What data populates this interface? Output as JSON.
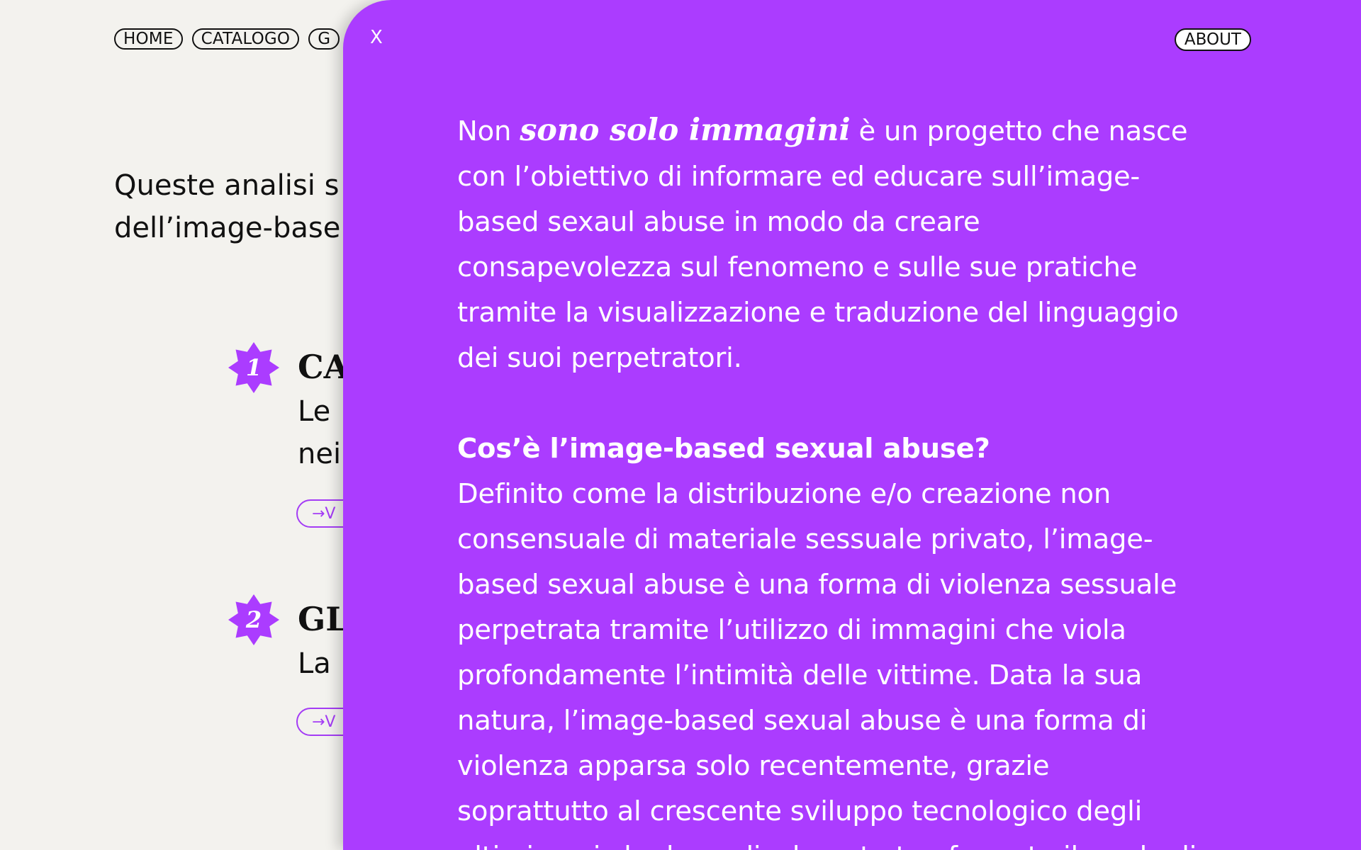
{
  "nav": {
    "items": [
      {
        "label": "HOME"
      },
      {
        "label": "CATALOGO"
      },
      {
        "label": "G"
      }
    ]
  },
  "intro": {
    "lines": [
      "Queste analisi s",
      "dell’image-base"
    ]
  },
  "steps": [
    {
      "number": "1",
      "title": "CA",
      "lines": [
        "Le",
        "nei"
      ],
      "button": "→V"
    },
    {
      "number": "2",
      "title": "GL",
      "lines": [
        "La"
      ],
      "button": "→V"
    }
  ],
  "about": {
    "close_label": "X",
    "pill_label": "ABOUT",
    "intro_prefix": "Non ",
    "intro_emphasis": "sono solo immagini",
    "intro_lines": [
      " è un progetto che nasce",
      "con l’obiettivo di informare ed educare sull’image-",
      "based sexaul abuse in modo da creare",
      "consapevolezza sul fenomeno e sulle sue pratiche",
      "tramite la visualizzazione e traduzione del linguaggio",
      "dei suoi perpetratori."
    ],
    "heading": "Cos’è l’image-based sexual abuse?",
    "body_lines": [
      "Definito come la distribuzione e/o creazione non",
      "consensuale di materiale sessuale privato, l’image-",
      "based sexual abuse è una forma di violenza sessuale",
      "perpetrata tramite l’utilizzo di immagini che viola",
      "profondamente l’intimità delle vittime. Data la sua",
      "natura, l’image-based sexual abuse è una forma di",
      "violenza apparsa solo recentemente, grazie",
      "soprattutto al crescente sviluppo tecnologico degli",
      "ultimi anni che ha radicalmente trasformato il modo di"
    ]
  },
  "colors": {
    "accent": "#ab3cff",
    "background": "#f3f2ee"
  }
}
